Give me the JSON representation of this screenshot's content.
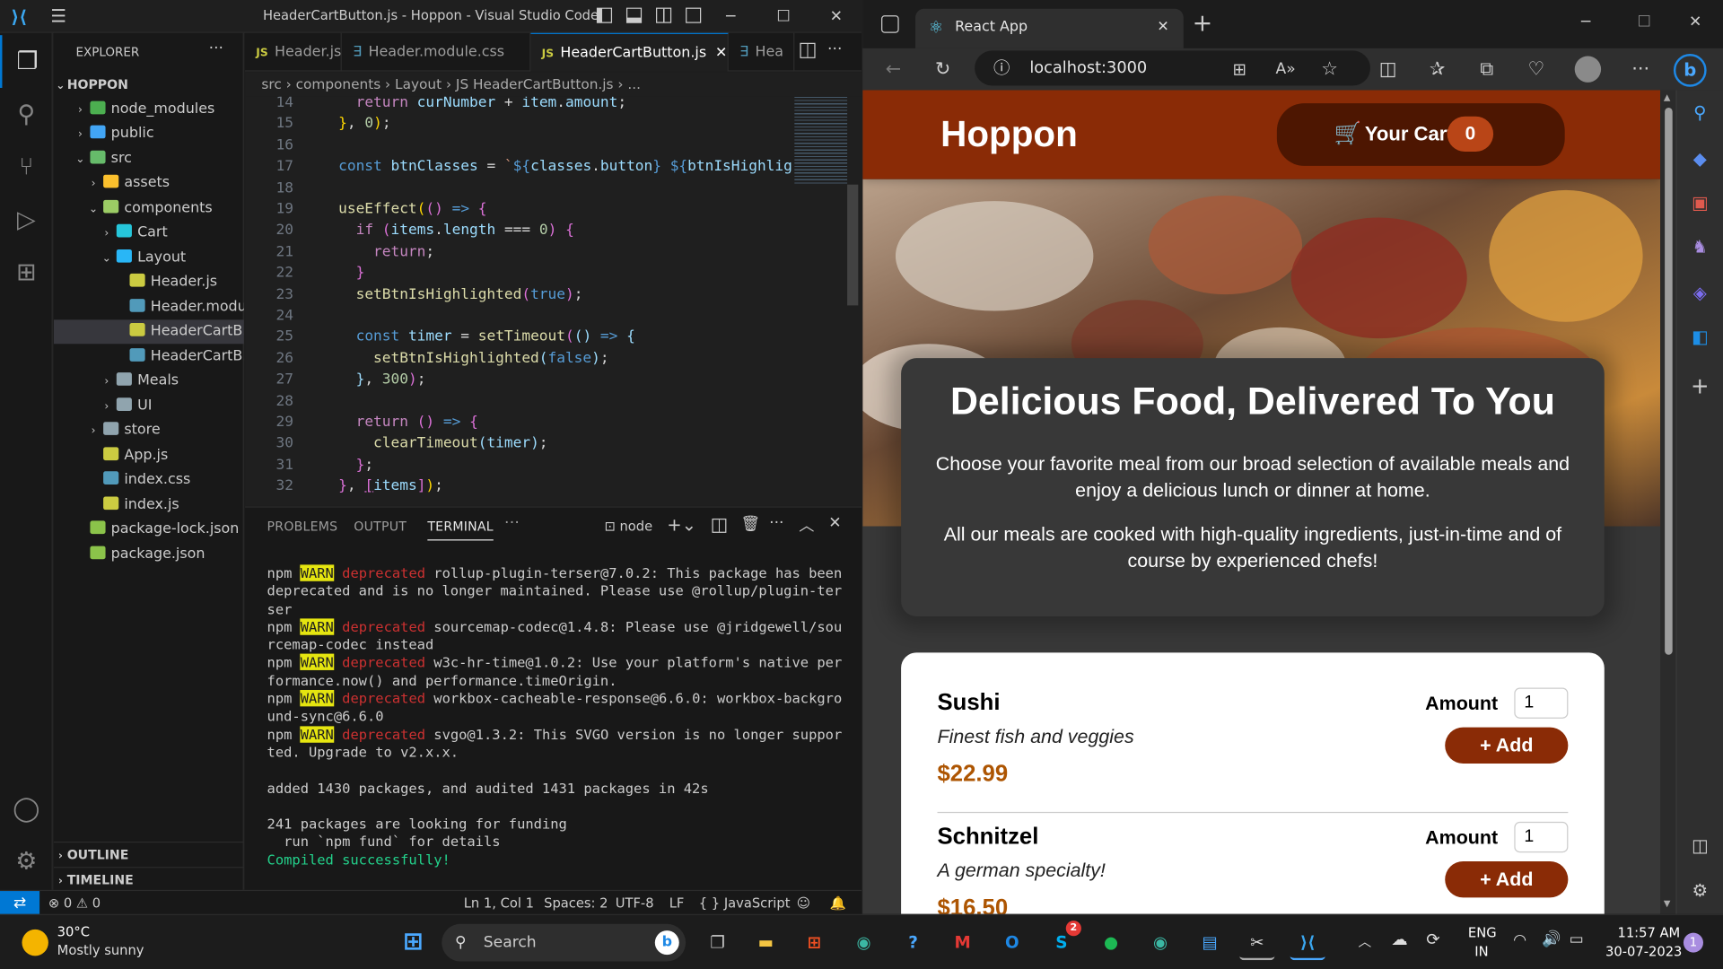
{
  "vscode": {
    "window_title": "HeaderCartButton.js - Hoppon - Visual Studio Code",
    "explorer_label": "EXPLORER",
    "project": "HOPPON",
    "tree": [
      {
        "label": "node_modules",
        "indent": 1,
        "chev": "›",
        "icon": "#4caf50"
      },
      {
        "label": "public",
        "indent": 1,
        "chev": "›",
        "icon": "#42a5f5"
      },
      {
        "label": "src",
        "indent": 1,
        "chev": "⌄",
        "icon": "#66bb6a"
      },
      {
        "label": "assets",
        "indent": 2,
        "chev": "›",
        "icon": "#fbc02d"
      },
      {
        "label": "components",
        "indent": 2,
        "chev": "⌄",
        "icon": "#9ccc65"
      },
      {
        "label": "Cart",
        "indent": 3,
        "chev": "›",
        "icon": "#26c6da"
      },
      {
        "label": "Layout",
        "indent": 3,
        "chev": "⌄",
        "icon": "#29b6f6"
      },
      {
        "label": "Header.js",
        "indent": 4,
        "chev": "",
        "icon": "#cbcb41"
      },
      {
        "label": "Header.modu...",
        "indent": 4,
        "chev": "",
        "icon": "#519aba"
      },
      {
        "label": "HeaderCartB...",
        "indent": 4,
        "chev": "",
        "icon": "#cbcb41",
        "selected": true
      },
      {
        "label": "HeaderCartB...",
        "indent": 4,
        "chev": "",
        "icon": "#519aba"
      },
      {
        "label": "Meals",
        "indent": 3,
        "chev": "›",
        "icon": "#90a4ae"
      },
      {
        "label": "UI",
        "indent": 3,
        "chev": "›",
        "icon": "#90a4ae"
      },
      {
        "label": "store",
        "indent": 2,
        "chev": "›",
        "icon": "#90a4ae"
      },
      {
        "label": "App.js",
        "indent": 2,
        "chev": "",
        "icon": "#cbcb41"
      },
      {
        "label": "index.css",
        "indent": 2,
        "chev": "",
        "icon": "#519aba"
      },
      {
        "label": "index.js",
        "indent": 2,
        "chev": "",
        "icon": "#cbcb41"
      },
      {
        "label": "package-lock.json",
        "indent": 1,
        "chev": "",
        "icon": "#8bc34a"
      },
      {
        "label": "package.json",
        "indent": 1,
        "chev": "",
        "icon": "#8bc34a"
      }
    ],
    "outline_label": "OUTLINE",
    "timeline_label": "TIMELINE",
    "tabs": [
      {
        "label": "Header.js"
      },
      {
        "label": "Header.module.css"
      },
      {
        "label": "HeaderCartButton.js",
        "active": true
      },
      {
        "label": "Hea"
      }
    ],
    "breadcrumb": "src › components › Layout › JS HeaderCartButton.js › ...",
    "line_numbers": [
      "14",
      "15",
      "16",
      "17",
      "18",
      "19",
      "20",
      "21",
      "22",
      "23",
      "24",
      "25",
      "26",
      "27",
      "28",
      "29",
      "30",
      "31",
      "32"
    ],
    "panel_tabs": [
      "PROBLEMS",
      "OUTPUT",
      "TERMINAL"
    ],
    "terminal_name": "node",
    "terminal": {
      "npm": "npm",
      "warn": "WARN",
      "deprecated": "deprecated",
      "l1": " rollup-plugin-terser@7.0.2: This package has been deprecated and is no longer maintained. Please use @rollup/plugin-terser",
      "l2": " sourcemap-codec@1.4.8: Please use @jridgewell/sourcemap-codec instead",
      "l3": " w3c-hr-time@1.0.2: Use your platform's native performance.now() and performance.timeOrigin.",
      "l4": " workbox-cacheable-response@6.6.0: workbox-background-sync@6.6.0",
      "l5": " svgo@1.3.2: This SVGO version is no longer supported. Upgrade to v2.x.x.",
      "added": "added 1430 packages, and audited 1431 packages in 42s",
      "funding1": "241 packages are looking for funding",
      "funding2": "  run `npm fund` for details",
      "compiled": "Compiled successfully!"
    },
    "status": {
      "problems": "⊗ 0 ⚠ 0",
      "position": "Ln 1, Col 1",
      "spaces": "Spaces: 2",
      "encoding": "UTF-8",
      "eol": "LF",
      "language": "{ } JavaScript"
    }
  },
  "edge": {
    "tab_title": "React App",
    "url": "localhost:3000"
  },
  "app": {
    "logo": "Hoppon",
    "cart_label": "Your Cart",
    "cart_count": "0",
    "summary_title": "Delicious Food, Delivered To You",
    "summary_p1": "Choose your favorite meal from our broad selection of available meals and enjoy a delicious lunch or dinner at home.",
    "summary_p2": "All our meals are cooked with high-quality ingredients, just-in-time and of course by experienced chefs!",
    "amount_label": "Amount",
    "add_label": "+ Add",
    "meals": [
      {
        "name": "Sushi",
        "description": "Finest fish and veggies",
        "price": "$22.99",
        "amount": "1"
      },
      {
        "name": "Schnitzel",
        "description": "A german specialty!",
        "price": "$16.50",
        "amount": "1"
      }
    ]
  },
  "taskbar": {
    "weather_temp": "30°C",
    "weather_text": "Mostly sunny",
    "search": "Search",
    "lang1": "ENG",
    "lang2": "IN",
    "time": "11:57 AM",
    "date": "30-07-2023",
    "notif": "1",
    "skype_badge": "2"
  }
}
